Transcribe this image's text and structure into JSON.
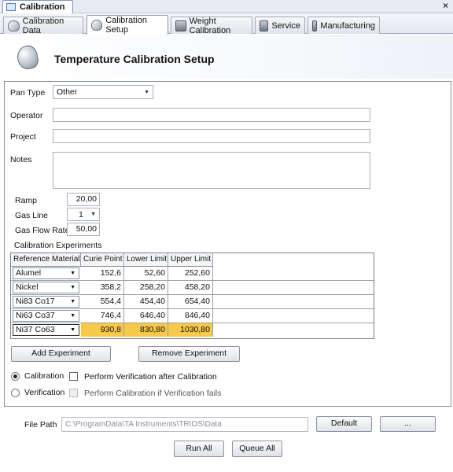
{
  "window": {
    "doc_tab_label": "Calibration",
    "close_glyph": "×"
  },
  "tabs": [
    {
      "label": "Calibration Data",
      "icon": "pan-icon"
    },
    {
      "label": "Calibration Setup",
      "icon": "pan-icon",
      "active": true
    },
    {
      "label": "Weight Calibration",
      "icon": "scale-icon"
    },
    {
      "label": "Service",
      "icon": "scale-icon"
    },
    {
      "label": "Manufacturing",
      "icon": "scale-icon"
    }
  ],
  "header": {
    "title": "Temperature Calibration Setup"
  },
  "form": {
    "pan_type_label": "Pan Type",
    "pan_type_value": "Other",
    "operator_label": "Operator",
    "operator_value": "",
    "project_label": "Project",
    "project_value": "",
    "notes_label": "Notes",
    "notes_value": "",
    "ramp_label": "Ramp",
    "ramp_value": "20,00",
    "gas_line_label": "Gas Line",
    "gas_line_value": "1",
    "gas_flow_label": "Gas Flow Rate",
    "gas_flow_value": "50,00",
    "experiments_label": "Calibration Experiments"
  },
  "grid": {
    "headers": [
      "Reference Material",
      "Curie Point",
      "Lower Limit",
      "Upper Limit"
    ],
    "rows": [
      {
        "material": "Alumel",
        "curie": "152,6",
        "lower": "52,60",
        "upper": "252,60"
      },
      {
        "material": "Nickel",
        "curie": "358,2",
        "lower": "258,20",
        "upper": "458,20"
      },
      {
        "material": "Ni83 Co17",
        "curie": "554,4",
        "lower": "454,40",
        "upper": "654,40"
      },
      {
        "material": "Ni63 Co37",
        "curie": "746,4",
        "lower": "646,40",
        "upper": "846,40"
      },
      {
        "material": "Ni37 Co63",
        "curie": "930,8",
        "lower": "830,80",
        "upper": "1030,80",
        "selected": true
      }
    ]
  },
  "buttons": {
    "add_experiment": "Add Experiment",
    "remove_experiment": "Remove Experiment",
    "default": "Default",
    "browse": "...",
    "run_all": "Run All",
    "queue_all": "Queue All"
  },
  "mode": {
    "calibration_label": "Calibration",
    "verification_label": "Verification",
    "selected": "calibration",
    "perform_verification_label": "Perform Verification after Calibration",
    "perform_calibration_label": "Perform Calibration if Verification fails"
  },
  "file": {
    "label": "File Path",
    "value": "C:\\ProgramData\\TA Instruments\\TRIOS\\Data"
  },
  "colors": {
    "selection": "#f7c94a",
    "accent": "#4a78c0"
  }
}
